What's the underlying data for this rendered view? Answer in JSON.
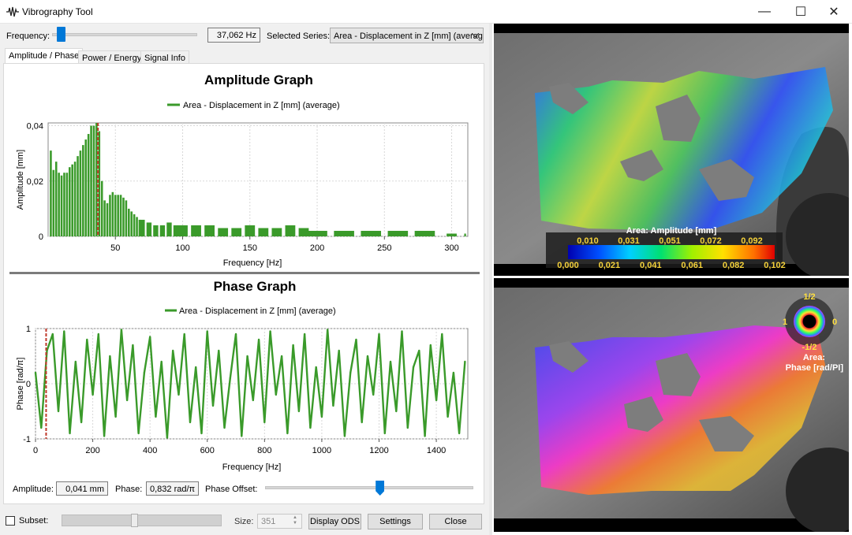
{
  "window": {
    "title": "Vibrography Tool",
    "minimize": "—",
    "maximize": "☐",
    "close": "✕"
  },
  "controls": {
    "frequency_label": "Frequency:",
    "frequency_value": "37,062 Hz",
    "frequency_slider_position": 0.06,
    "series_label": "Selected Series:",
    "series_value": "Area - Displacement in Z [mm] (average"
  },
  "tabs": [
    "Amplitude / Phase",
    "Power / Energy",
    "Signal Info"
  ],
  "amplitude_graph": {
    "title": "Amplitude Graph",
    "legend": "Area - Displacement in Z [mm] (average)",
    "ylabel": "Amplitude [mm]",
    "xlabel": "Frequency [Hz]",
    "yticks": [
      "0,04",
      "0,02",
      "0"
    ],
    "xticks": [
      "50",
      "100",
      "150",
      "200",
      "250",
      "300"
    ]
  },
  "phase_graph": {
    "title": "Phase Graph",
    "legend": "Area - Displacement in Z [mm] (average)",
    "ylabel": "Phase [rad/π]",
    "xlabel": "Frequency [Hz]",
    "yticks": [
      "1",
      "0",
      "-1"
    ],
    "xticks": [
      "0",
      "200",
      "400",
      "600",
      "800",
      "1000",
      "1200",
      "1400"
    ]
  },
  "readouts": {
    "amplitude_label": "Amplitude:",
    "amplitude_value": "0,041 mm",
    "phase_label": "Phase:",
    "phase_value": "0,832 rad/π",
    "phase_offset_label": "Phase Offset:",
    "phase_offset_position": 0.55
  },
  "footer": {
    "subset_label": "Subset:",
    "size_label": "Size:",
    "size_value": "351",
    "display_ods": "Display ODS",
    "settings": "Settings",
    "close": "Close"
  },
  "amplitude_map": {
    "title": "Area: Amplitude [mm]",
    "top_labels": [
      "0,010",
      "0,031",
      "0,051",
      "0,072",
      "0,092"
    ],
    "bottom_labels": [
      "0,000",
      "0,021",
      "0,041",
      "0,061",
      "0,082",
      "0,102"
    ]
  },
  "phase_map": {
    "wheel_top": "1/2",
    "wheel_left": "1",
    "wheel_right": "0",
    "wheel_bottom": "-1/2",
    "title_line1": "Area:",
    "title_line2": "Phase [rad/PI]"
  },
  "colors": {
    "series": "#3a9a2a",
    "marker": "#c0392b",
    "accent": "#0078d7"
  },
  "chart_data": [
    {
      "type": "bar",
      "title": "Amplitude Graph",
      "xlabel": "Frequency [Hz]",
      "ylabel": "Amplitude [mm]",
      "xlim": [
        0,
        312
      ],
      "ylim": [
        0,
        0.041
      ],
      "marker_x": 37.062,
      "series": [
        {
          "name": "Area - Displacement in Z [mm] (average)",
          "x": [
            2,
            4,
            6,
            8,
            10,
            12,
            14,
            16,
            18,
            20,
            22,
            24,
            26,
            28,
            30,
            32,
            34,
            36,
            38,
            40,
            42,
            44,
            46,
            48,
            50,
            52,
            54,
            56,
            58,
            60,
            62,
            64,
            66,
            68,
            70,
            75,
            80,
            85,
            90,
            95,
            100,
            110,
            120,
            130,
            140,
            150,
            160,
            170,
            180,
            190,
            200,
            220,
            240,
            260,
            280,
            300,
            310
          ],
          "values": [
            0.031,
            0.024,
            0.027,
            0.023,
            0.022,
            0.023,
            0.023,
            0.025,
            0.026,
            0.027,
            0.029,
            0.031,
            0.033,
            0.035,
            0.037,
            0.04,
            0.04,
            0.041,
            0.038,
            0.02,
            0.013,
            0.012,
            0.015,
            0.016,
            0.015,
            0.015,
            0.015,
            0.014,
            0.013,
            0.01,
            0.009,
            0.008,
            0.007,
            0.006,
            0.006,
            0.005,
            0.004,
            0.004,
            0.005,
            0.004,
            0.004,
            0.004,
            0.004,
            0.003,
            0.003,
            0.004,
            0.003,
            0.003,
            0.004,
            0.003,
            0.002,
            0.002,
            0.002,
            0.002,
            0.002,
            0.001,
            0.001
          ]
        }
      ]
    },
    {
      "type": "line",
      "title": "Phase Graph",
      "xlabel": "Frequency [Hz]",
      "ylabel": "Phase [rad/π]",
      "xlim": [
        0,
        1510
      ],
      "ylim": [
        -1,
        1
      ],
      "marker_x": 37.062,
      "series": [
        {
          "name": "Area - Displacement in Z [mm] (average)",
          "x": [
            0,
            20,
            40,
            60,
            80,
            100,
            120,
            140,
            160,
            180,
            200,
            220,
            240,
            260,
            280,
            300,
            320,
            340,
            360,
            380,
            400,
            420,
            440,
            460,
            480,
            500,
            520,
            540,
            560,
            580,
            600,
            620,
            640,
            660,
            680,
            700,
            720,
            740,
            760,
            780,
            800,
            820,
            840,
            860,
            880,
            900,
            920,
            940,
            960,
            980,
            1000,
            1020,
            1040,
            1060,
            1080,
            1100,
            1120,
            1140,
            1160,
            1180,
            1200,
            1220,
            1240,
            1260,
            1280,
            1300,
            1320,
            1340,
            1360,
            1380,
            1400,
            1420,
            1440,
            1460,
            1480,
            1500
          ],
          "values": [
            0.2,
            -0.8,
            0.6,
            0.9,
            -0.5,
            0.95,
            -0.9,
            0.4,
            -0.7,
            0.8,
            -0.2,
            0.9,
            -0.95,
            0.5,
            -0.6,
            0.98,
            -0.3,
            0.7,
            -0.9,
            0.2,
            0.85,
            -0.6,
            0.4,
            -0.98,
            0.6,
            -0.2,
            0.9,
            -0.7,
            0.3,
            -0.9,
            0.95,
            -0.4,
            0.6,
            -0.8,
            0.1,
            0.9,
            -0.95,
            0.5,
            -0.3,
            0.8,
            -0.7,
            0.95,
            -0.2,
            0.5,
            -0.9,
            0.7,
            -0.5,
            0.9,
            -0.8,
            0.3,
            -0.6,
            0.98,
            -0.4,
            0.6,
            -0.95,
            0.2,
            0.8,
            -0.7,
            0.5,
            -0.2,
            0.9,
            -0.9,
            0.4,
            -0.5,
            0.95,
            -0.8,
            0.3,
            0.6,
            -0.95,
            0.7,
            -0.3,
            0.9,
            -0.6,
            0.2,
            -0.9,
            0.4
          ]
        }
      ]
    }
  ]
}
